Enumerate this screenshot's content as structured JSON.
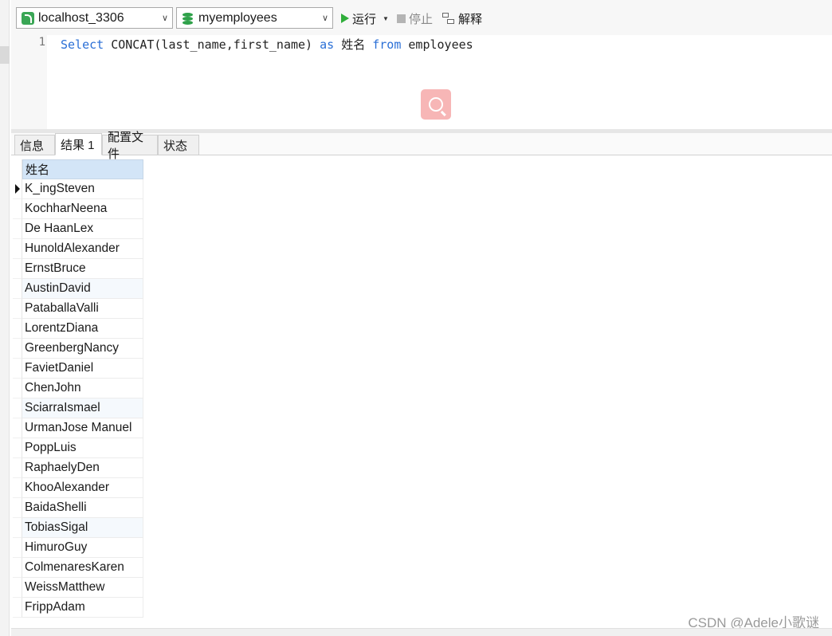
{
  "toolbar": {
    "connection": "localhost_3306",
    "database": "myemployees",
    "run_label": "运行",
    "stop_label": "停止",
    "explain_label": "解释"
  },
  "editor": {
    "line_number": "1",
    "tokens": {
      "select": "Select",
      "func": " CONCAT(last_name,first_name) ",
      "as": "as",
      "alias": " 姓名 ",
      "from": "from",
      "table": " employees"
    }
  },
  "tabs": [
    {
      "label": "信息"
    },
    {
      "label": "结果 1"
    },
    {
      "label": "配置文件"
    },
    {
      "label": "状态"
    }
  ],
  "result": {
    "column": "姓名",
    "rows": [
      "K_ingSteven",
      "KochharNeena",
      "De HaanLex",
      "HunoldAlexander",
      "ErnstBruce",
      "AustinDavid",
      "PataballaValli",
      "LorentzDiana",
      "GreenbergNancy",
      "FavietDaniel",
      "ChenJohn",
      "SciarraIsmael",
      "UrmanJose Manuel",
      "PoppLuis",
      "RaphaelyDen",
      "KhooAlexander",
      "BaidaShelli",
      "TobiasSigal",
      "HimuroGuy",
      "ColmenaresKaren",
      "WeissMatthew",
      "FrippAdam"
    ]
  },
  "watermark": "CSDN @Adele小歌谜",
  "colors": {
    "keyword": "#2a6fd6",
    "run_icon": "#2fae3a",
    "header_bg": "#d3e5f7",
    "search_fab": "#f7b6b6"
  }
}
